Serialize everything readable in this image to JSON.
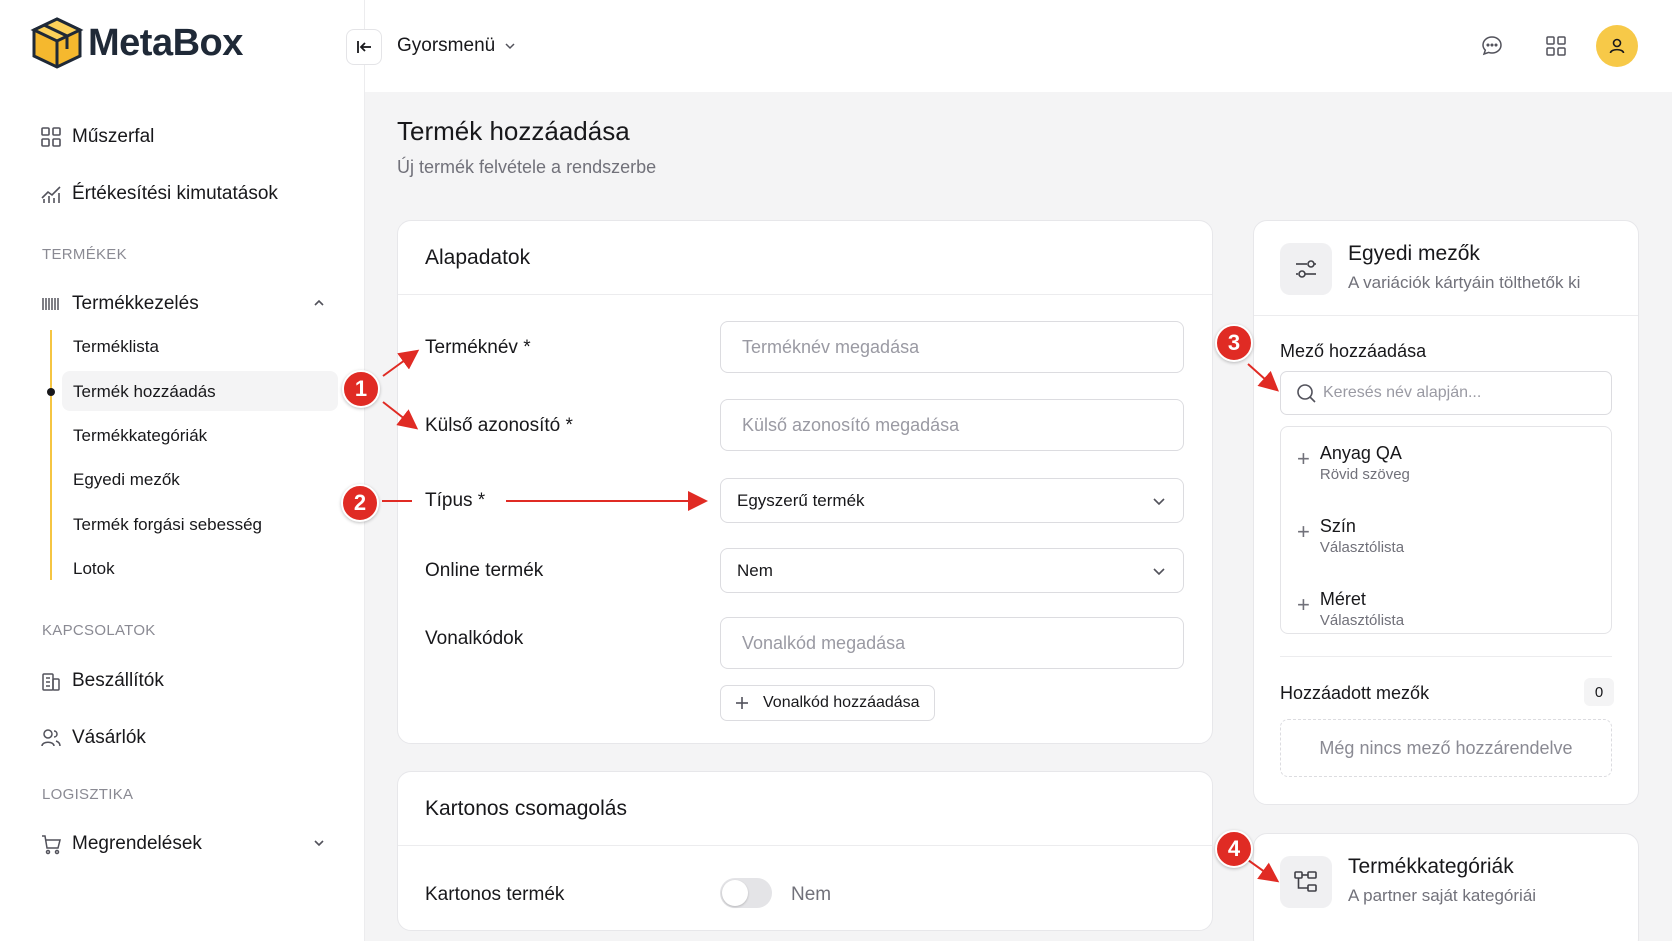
{
  "app": {
    "name": "MetaBox"
  },
  "sidebar": {
    "items": [
      {
        "label": "Műszerfal",
        "icon": "grid-icon"
      },
      {
        "label": "Értékesítési kimutatások",
        "icon": "chart-icon"
      }
    ],
    "sections": {
      "products": {
        "label": "TERMÉKEK",
        "group_label": "Termékkezelés",
        "subitems": [
          "Terméklista",
          "Termék hozzáadás",
          "Termékkategóriák",
          "Egyedi mezők",
          "Termék forgási sebesség",
          "Lotok"
        ]
      },
      "contacts": {
        "label": "KAPCSOLATOK",
        "items": [
          "Beszállítók",
          "Vásárlók"
        ]
      },
      "logistics": {
        "label": "LOGISZTIKA",
        "items": [
          "Megrendelések"
        ]
      }
    }
  },
  "topbar": {
    "quickmenu": "Gyorsmenü"
  },
  "page": {
    "title": "Termék hozzáadása",
    "subtitle": "Új termék felvétele a rendszerbe"
  },
  "basic": {
    "title": "Alapadatok",
    "name_label": "Terméknév *",
    "name_placeholder": "Terméknév megadása",
    "extid_label": "Külső azonosító *",
    "extid_placeholder": "Külső azonosító megadása",
    "type_label": "Típus *",
    "type_value": "Egyszerű termék",
    "online_label": "Online termék",
    "online_value": "Nem",
    "barcode_label": "Vonalkódok",
    "barcode_placeholder": "Vonalkód megadása",
    "barcode_add": "Vonalkód hozzáadása"
  },
  "carton": {
    "title": "Kartonos csomagolás",
    "label": "Kartonos termék",
    "value": "Nem"
  },
  "custom": {
    "title": "Egyedi mezők",
    "subtitle": "A variációk kártyáin tölthetők ki",
    "add_label": "Mező hozzáadása",
    "search_placeholder": "Keresés név alapján...",
    "fields": [
      {
        "name": "Anyag QA",
        "type": "Rövid szöveg"
      },
      {
        "name": "Szín",
        "type": "Választólista"
      },
      {
        "name": "Méret",
        "type": "Választólista"
      }
    ],
    "added_label": "Hozzáadott mezők",
    "added_count": "0",
    "empty_text": "Még nincs mező hozzárendelve"
  },
  "categories": {
    "title": "Termékkategóriák",
    "subtitle": "A partner saját kategóriái"
  },
  "annotations": [
    "1",
    "2",
    "3",
    "4"
  ],
  "colors": {
    "accent": "#f7c948",
    "annotation": "#e02b24"
  }
}
